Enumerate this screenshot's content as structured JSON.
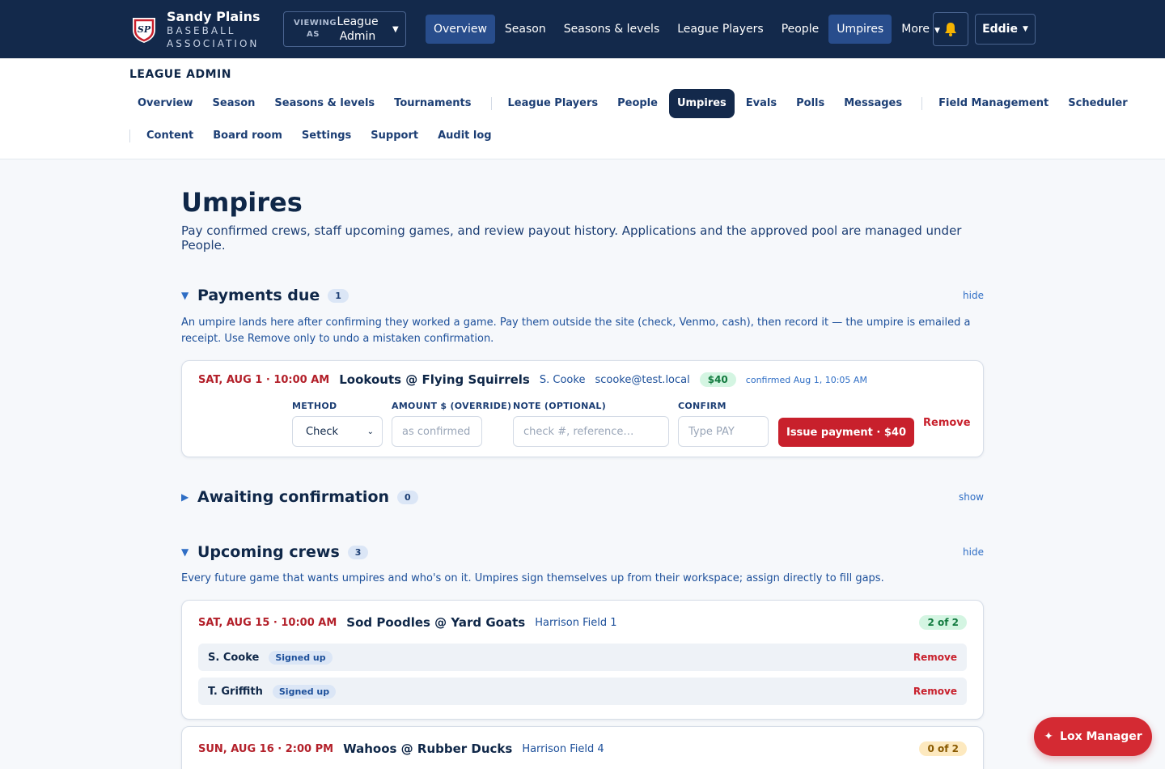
{
  "brand": {
    "name": "Sandy Plains",
    "sub1": "BASEBALL",
    "sub2": "ASSOCIATION",
    "logo_text": "SP"
  },
  "viewing": {
    "label1": "VIEWING",
    "label2": "AS",
    "value1": "League",
    "value2": "Admin"
  },
  "topnav": [
    "Overview",
    "Season",
    "Seasons & levels",
    "League Players",
    "People",
    "Umpires",
    "More"
  ],
  "topnav_active": [
    "Overview",
    "Umpires"
  ],
  "user": {
    "name": "Eddie"
  },
  "subnav": {
    "title": "LEAGUE ADMIN",
    "row1": [
      "Overview",
      "Season",
      "Seasons & levels",
      "Tournaments",
      "League Players",
      "People",
      "Umpires",
      "Evals",
      "Polls",
      "Messages",
      "Field Management",
      "Scheduler"
    ],
    "row2": [
      "Content",
      "Board room",
      "Settings",
      "Support",
      "Audit log"
    ],
    "active": "Umpires"
  },
  "page": {
    "title": "Umpires",
    "lead": "Pay confirmed crews, staff upcoming games, and review payout history. Applications and the approved pool are managed under People."
  },
  "payments": {
    "title": "Payments due",
    "count": "1",
    "toggle": "hide",
    "desc": "An umpire lands here after confirming they worked a game. Pay them outside the site (check, Venmo, cash), then record it — the umpire is emailed a receipt. Use Remove only to undo a mistaken confirmation.",
    "item": {
      "when": "SAT, AUG 1 · 10:00 AM",
      "match": "Lookouts @ Flying Squirrels",
      "umpire": "S. Cooke",
      "email": "scooke@test.local",
      "amount": "$40",
      "confirmed": "confirmed Aug 1, 10:05 AM",
      "method_label": "METHOD",
      "method_value": "Check",
      "amount_label": "AMOUNT $ (OVERRIDE)",
      "amount_placeholder": "as confirmed",
      "note_label": "NOTE (OPTIONAL)",
      "note_placeholder": "check #, reference…",
      "confirm_label": "CONFIRM",
      "confirm_placeholder": "Type PAY",
      "pay_button": "Issue payment · $40",
      "remove": "Remove"
    }
  },
  "awaiting": {
    "title": "Awaiting confirmation",
    "count": "0",
    "toggle": "show"
  },
  "crews": {
    "title": "Upcoming crews",
    "count": "3",
    "toggle": "hide",
    "desc": "Every future game that wants umpires and who's on it. Umpires sign themselves up from their workspace; assign directly to fill gaps.",
    "games": [
      {
        "when": "SAT, AUG 15 · 10:00 AM",
        "match": "Sod Poodles @ Yard Goats",
        "field": "Harrison Field 1",
        "fill": "2 of 2",
        "umpires": [
          {
            "name": "S. Cooke",
            "status": "Signed up",
            "action": "Remove"
          },
          {
            "name": "T. Griffith",
            "status": "Signed up",
            "action": "Remove"
          }
        ]
      },
      {
        "when": "SUN, AUG 16 · 2:00 PM",
        "match": "Wahoos @ Rubber Ducks",
        "field": "Harrison Field 4",
        "fill": "0 of 2",
        "umpires": []
      }
    ]
  },
  "fab": {
    "label": "Lox Manager"
  },
  "colors": {
    "navy": "#13294b",
    "accent_blue": "#284d8c",
    "danger": "#c8202c",
    "success_bg": "#d4f5e2",
    "warn_bg": "#fde9bf"
  },
  "icons": {
    "logo": "shield-logo-icon",
    "bell": "bell-icon",
    "caret": "caret-down-icon",
    "fab": "sparkle-icon",
    "section_open": "triangle-down-icon",
    "section_closed": "triangle-right-icon"
  }
}
